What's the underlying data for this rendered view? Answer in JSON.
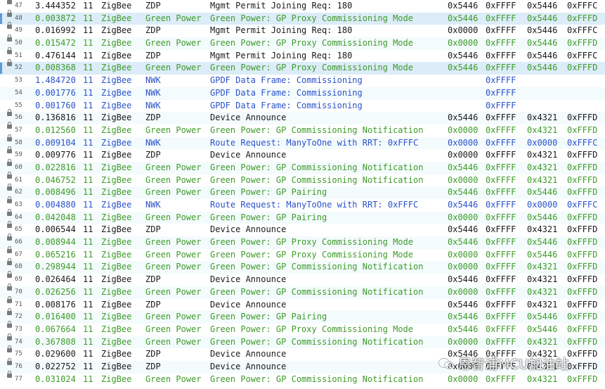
{
  "packets": [
    {
      "no": "47",
      "time": "3.444352",
      "ch": "11",
      "net": "ZigBee",
      "layer": "ZDP",
      "info": "Mgmt Permit Joining Req: 180",
      "a1": "0x5446",
      "a2": "0xFFFF",
      "a3": "0x5446",
      "a4": "0xFFFC",
      "type": "zdp",
      "locked": true,
      "selected": false
    },
    {
      "no": "48",
      "time": "0.003872",
      "ch": "11",
      "net": "ZigBee",
      "layer": "Green Power",
      "info": "Green Power: GP Proxy Commissioning Mode",
      "a1": "0x5446",
      "a2": "0xFFFF",
      "a3": "0x5446",
      "a4": "0xFFFD",
      "type": "gp",
      "locked": true,
      "selected": true
    },
    {
      "no": "49",
      "time": "0.016992",
      "ch": "11",
      "net": "ZigBee",
      "layer": "ZDP",
      "info": "Mgmt Permit Joining Req: 180",
      "a1": "0x0000",
      "a2": "0xFFFF",
      "a3": "0x5446",
      "a4": "0xFFFC",
      "type": "zdp",
      "locked": true,
      "selected": false
    },
    {
      "no": "50",
      "time": "0.015472",
      "ch": "11",
      "net": "ZigBee",
      "layer": "Green Power",
      "info": "Green Power: GP Proxy Commissioning Mode",
      "a1": "0x0000",
      "a2": "0xFFFF",
      "a3": "0x5446",
      "a4": "0xFFFD",
      "type": "gp",
      "locked": true,
      "selected": false
    },
    {
      "no": "51",
      "time": "0.476144",
      "ch": "11",
      "net": "ZigBee",
      "layer": "ZDP",
      "info": "Mgmt Permit Joining Req: 180",
      "a1": "0x5446",
      "a2": "0xFFFF",
      "a3": "0x5446",
      "a4": "0xFFFC",
      "type": "zdp",
      "locked": true,
      "selected": false
    },
    {
      "no": "52",
      "time": "0.008368",
      "ch": "11",
      "net": "ZigBee",
      "layer": "Green Power",
      "info": "Green Power: GP Proxy Commissioning Mode",
      "a1": "0x5446",
      "a2": "0xFFFF",
      "a3": "0x5446",
      "a4": "0xFFFD",
      "type": "gp",
      "locked": true,
      "selected": true
    },
    {
      "no": "53",
      "time": "1.484720",
      "ch": "11",
      "net": "ZigBee",
      "layer": "NWK",
      "info": "GPDF Data Frame: Commissioning",
      "a1": "",
      "a2": "0xFFFF",
      "a3": "",
      "a4": "",
      "type": "nwk",
      "locked": false,
      "selected": false
    },
    {
      "no": "54",
      "time": "0.001776",
      "ch": "11",
      "net": "ZigBee",
      "layer": "NWK",
      "info": "GPDF Data Frame: Commissioning",
      "a1": "",
      "a2": "0xFFFF",
      "a3": "",
      "a4": "",
      "type": "nwk",
      "locked": false,
      "selected": false
    },
    {
      "no": "55",
      "time": "0.001760",
      "ch": "11",
      "net": "ZigBee",
      "layer": "NWK",
      "info": "GPDF Data Frame: Commissioning",
      "a1": "",
      "a2": "0xFFFF",
      "a3": "",
      "a4": "",
      "type": "nwk",
      "locked": false,
      "selected": false
    },
    {
      "no": "56",
      "time": "0.136816",
      "ch": "11",
      "net": "ZigBee",
      "layer": "ZDP",
      "info": "Device Announce",
      "a1": "0x5446",
      "a2": "0xFFFF",
      "a3": "0x4321",
      "a4": "0xFFFD",
      "type": "zdp",
      "locked": true,
      "selected": false
    },
    {
      "no": "57",
      "time": "0.012560",
      "ch": "11",
      "net": "ZigBee",
      "layer": "Green Power",
      "info": "Green Power: GP Commissioning Notification",
      "a1": "0x0000",
      "a2": "0xFFFF",
      "a3": "0x4321",
      "a4": "0xFFFD",
      "type": "gp",
      "locked": true,
      "selected": false
    },
    {
      "no": "58",
      "time": "0.009104",
      "ch": "11",
      "net": "ZigBee",
      "layer": "NWK",
      "info": "Route Request: ManyToOne with RRT: 0xFFFC",
      "a1": "0x0000",
      "a2": "0xFFFF",
      "a3": "0x0000",
      "a4": "0xFFFC",
      "type": "nwk",
      "locked": true,
      "selected": false
    },
    {
      "no": "59",
      "time": "0.009776",
      "ch": "11",
      "net": "ZigBee",
      "layer": "ZDP",
      "info": "Device Announce",
      "a1": "0x0000",
      "a2": "0xFFFF",
      "a3": "0x4321",
      "a4": "0xFFFD",
      "type": "zdp",
      "locked": true,
      "selected": false
    },
    {
      "no": "60",
      "time": "0.022816",
      "ch": "11",
      "net": "ZigBee",
      "layer": "Green Power",
      "info": "Green Power: GP Commissioning Notification",
      "a1": "0x5446",
      "a2": "0xFFFF",
      "a3": "0x4321",
      "a4": "0xFFFD",
      "type": "gp",
      "locked": true,
      "selected": false
    },
    {
      "no": "61",
      "time": "0.046752",
      "ch": "11",
      "net": "ZigBee",
      "layer": "Green Power",
      "info": "Green Power: GP Commissioning Notification",
      "a1": "0x0000",
      "a2": "0xFFFF",
      "a3": "0x4321",
      "a4": "0xFFFD",
      "type": "gp",
      "locked": true,
      "selected": false
    },
    {
      "no": "62",
      "time": "0.008496",
      "ch": "11",
      "net": "ZigBee",
      "layer": "Green Power",
      "info": "Green Power: GP Pairing",
      "a1": "0x5446",
      "a2": "0xFFFF",
      "a3": "0x5446",
      "a4": "0xFFFD",
      "type": "gp",
      "locked": true,
      "selected": false
    },
    {
      "no": "63",
      "time": "0.004880",
      "ch": "11",
      "net": "ZigBee",
      "layer": "NWK",
      "info": "Route Request: ManyToOne with RRT: 0xFFFC",
      "a1": "0x5446",
      "a2": "0xFFFF",
      "a3": "0x0000",
      "a4": "0xFFFC",
      "type": "nwk",
      "locked": true,
      "selected": false
    },
    {
      "no": "64",
      "time": "0.042048",
      "ch": "11",
      "net": "ZigBee",
      "layer": "Green Power",
      "info": "Green Power: GP Pairing",
      "a1": "0x0000",
      "a2": "0xFFFF",
      "a3": "0x5446",
      "a4": "0xFFFD",
      "type": "gp",
      "locked": true,
      "selected": false
    },
    {
      "no": "65",
      "time": "0.006544",
      "ch": "11",
      "net": "ZigBee",
      "layer": "ZDP",
      "info": "Device Announce",
      "a1": "0x5446",
      "a2": "0xFFFF",
      "a3": "0x4321",
      "a4": "0xFFFD",
      "type": "zdp",
      "locked": true,
      "selected": false
    },
    {
      "no": "66",
      "time": "0.008944",
      "ch": "11",
      "net": "ZigBee",
      "layer": "Green Power",
      "info": "Green Power: GP Proxy Commissioning Mode",
      "a1": "0x5446",
      "a2": "0xFFFF",
      "a3": "0x5446",
      "a4": "0xFFFD",
      "type": "gp",
      "locked": true,
      "selected": false
    },
    {
      "no": "67",
      "time": "0.065216",
      "ch": "11",
      "net": "ZigBee",
      "layer": "Green Power",
      "info": "Green Power: GP Proxy Commissioning Mode",
      "a1": "0x0000",
      "a2": "0xFFFF",
      "a3": "0x5446",
      "a4": "0xFFFD",
      "type": "gp",
      "locked": true,
      "selected": false
    },
    {
      "no": "68",
      "time": "0.298944",
      "ch": "11",
      "net": "ZigBee",
      "layer": "Green Power",
      "info": "Green Power: GP Commissioning Notification",
      "a1": "0x0000",
      "a2": "0xFFFF",
      "a3": "0x4321",
      "a4": "0xFFFD",
      "type": "gp",
      "locked": true,
      "selected": false
    },
    {
      "no": "69",
      "time": "0.026464",
      "ch": "11",
      "net": "ZigBee",
      "layer": "ZDP",
      "info": "Device Announce",
      "a1": "0x5446",
      "a2": "0xFFFF",
      "a3": "0x4321",
      "a4": "0xFFFD",
      "type": "zdp",
      "locked": true,
      "selected": false
    },
    {
      "no": "70",
      "time": "0.026256",
      "ch": "11",
      "net": "ZigBee",
      "layer": "Green Power",
      "info": "Green Power: GP Commissioning Notification",
      "a1": "0x0000",
      "a2": "0xFFFF",
      "a3": "0x4321",
      "a4": "0xFFFD",
      "type": "gp",
      "locked": true,
      "selected": false
    },
    {
      "no": "71",
      "time": "0.008176",
      "ch": "11",
      "net": "ZigBee",
      "layer": "ZDP",
      "info": "Device Announce",
      "a1": "0x5446",
      "a2": "0xFFFF",
      "a3": "0x4321",
      "a4": "0xFFFD",
      "type": "zdp",
      "locked": true,
      "selected": false
    },
    {
      "no": "72",
      "time": "0.016400",
      "ch": "11",
      "net": "ZigBee",
      "layer": "Green Power",
      "info": "Green Power: GP Pairing",
      "a1": "0x5446",
      "a2": "0xFFFF",
      "a3": "0x5446",
      "a4": "0xFFFD",
      "type": "gp",
      "locked": true,
      "selected": false
    },
    {
      "no": "73",
      "time": "0.067664",
      "ch": "11",
      "net": "ZigBee",
      "layer": "Green Power",
      "info": "Green Power: GP Proxy Commissioning Mode",
      "a1": "0x5446",
      "a2": "0xFFFF",
      "a3": "0x5446",
      "a4": "0xFFFD",
      "type": "gp",
      "locked": true,
      "selected": false
    },
    {
      "no": "74",
      "time": "0.367808",
      "ch": "11",
      "net": "ZigBee",
      "layer": "Green Power",
      "info": "Green Power: GP Commissioning Notification",
      "a1": "0x0000",
      "a2": "0xFFFF",
      "a3": "0x4321",
      "a4": "0xFFFD",
      "type": "gp",
      "locked": true,
      "selected": false
    },
    {
      "no": "75",
      "time": "0.029600",
      "ch": "11",
      "net": "ZigBee",
      "layer": "ZDP",
      "info": "Device Announce",
      "a1": "0x5446",
      "a2": "0xFFFF",
      "a3": "0x4321",
      "a4": "0xFFFD",
      "type": "zdp",
      "locked": true,
      "selected": false
    },
    {
      "no": "76",
      "time": "0.022752",
      "ch": "11",
      "net": "ZigBee",
      "layer": "ZDP",
      "info": "Device Announce",
      "a1": "0x0000",
      "a2": "0xFFFF",
      "a3": "0x4321",
      "a4": "0xFFFD",
      "type": "zdp",
      "locked": true,
      "selected": false
    },
    {
      "no": "77",
      "time": "0.031024",
      "ch": "11",
      "net": "ZigBee",
      "layer": "Green Power",
      "info": "Green Power: GP Commissioning Notification",
      "a1": "0x0000",
      "a2": "0xFFFF",
      "a3": "0x4321",
      "a4": "0xFFFD",
      "type": "gp",
      "locked": true,
      "selected": false
    }
  ],
  "watermark": {
    "text": "恩智浦MCU加油站",
    "icon": "wechat-icon"
  },
  "colors": {
    "zdp": "#1a1a1a",
    "gp": "#3e9b29",
    "nwk": "#2a52c9",
    "selected_bg": "#dcecf8",
    "selected_bar": "#5b9bd5"
  }
}
